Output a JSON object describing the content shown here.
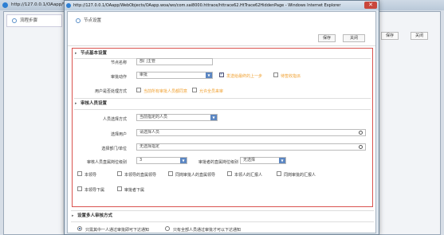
{
  "background_window": {
    "title": "http://127.0.0.1/OAapp/WebO...",
    "tab_label": "流程步骤",
    "buttons": [
      "保存",
      "关闭"
    ]
  },
  "dialog": {
    "title": "http://127.0.0.1/OAapp/WebObjects/OAapp.woa/wo/com.sai8000.httrace/httrace62.HtTrace62HiddenPage - Windows Internet Explorer",
    "close_glyph": "✕",
    "tab_label": "节点设置",
    "save_label": "保存",
    "close_label": "关闭",
    "section_basic": {
      "title": "节点基本设置",
      "node_name_label": "节点名称",
      "node_name_value": "部门主管",
      "action_label": "审批动作",
      "action_value": "审批",
      "option1": "发送给最终的上一步",
      "option1_checked": true,
      "option2": "待签收指派",
      "option2_checked": false,
      "handler_label": "用户是否处理方式",
      "handler_opt1": "当前所有审批人员都同意",
      "handler_opt2": "允许全员来审"
    },
    "section_approvers": {
      "title": "审核人员设置",
      "select_mode_label": "人员选择方式",
      "select_mode_value": "当前指定的人员",
      "choose_user_label": "选择用户",
      "choose_user_placeholder": "请选择人员",
      "choose_post_label": "选择部门/单位",
      "choose_post_placeholder": "无选择指定",
      "approver_level_label": "审核人员直属岗位级别",
      "approver_level_value": "3",
      "dept_level_label": "审批者的直属岗位级别",
      "dept_level_value": "无选择",
      "checkboxes": [
        "本领导",
        "本领导的直属领导",
        "同岗审批人的直属领导",
        "本领人的汇报人",
        "同岗审批的汇报人",
        "本领导下属",
        "审批者下属"
      ]
    },
    "section_notify": {
      "title": "设置多人审核方式",
      "radio1": "只需其中一人通过审批即可下达通知",
      "radio2": "只有全部人员通过审批才可以下达通知"
    }
  }
}
